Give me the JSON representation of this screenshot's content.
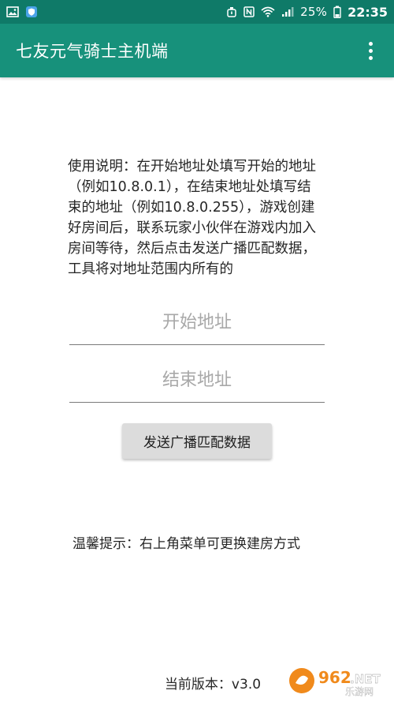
{
  "status_bar": {
    "battery_percent": "25%",
    "time": "22:35",
    "left_icons": [
      "image-icon",
      "shield-app-icon"
    ],
    "right_icons": [
      "alarm-icon",
      "nfc-icon",
      "wifi-icon",
      "signal-icon",
      "battery-icon"
    ]
  },
  "app_bar": {
    "title": "七友元气骑士主机端",
    "menu_icon": "more-vert-icon"
  },
  "instructions": {
    "text": "使用说明：在开始地址处填写开始的地址（例如10.8.0.1），在结束地址处填写结束的地址（例如10.8.0.255），游戏创建好房间后，联系玩家小伙伴在游戏内加入房间等待，然后点击发送广播匹配数据，工具将对地址范围内所有的"
  },
  "inputs": {
    "start_placeholder": "开始地址",
    "start_value": "",
    "end_placeholder": "结束地址",
    "end_value": ""
  },
  "send_button_label": "发送广播匹配数据",
  "tip": "温馨提示：右上角菜单可更换建房方式",
  "version": "当前版本：v3.0",
  "watermark_text": "962.NET 乐游网",
  "colors": {
    "status_bar": "#0f7a68",
    "app_bar": "#17917b",
    "button_bg": "#dcdcdc",
    "watermark_orange": "#f08a1c"
  }
}
